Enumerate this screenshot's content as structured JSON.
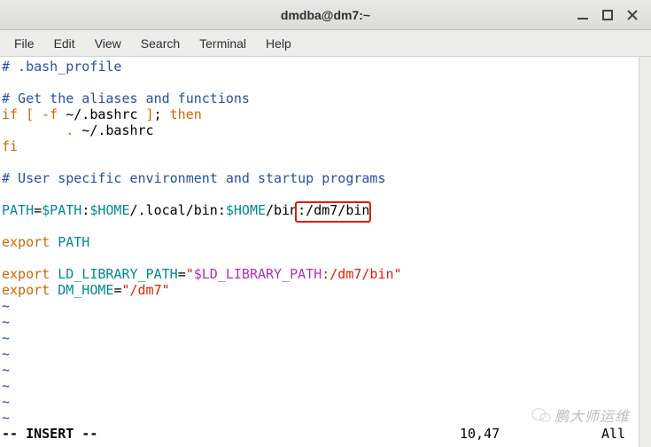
{
  "titlebar": {
    "title": "dmdba@dm7:~"
  },
  "menubar": {
    "file": "File",
    "edit": "Edit",
    "view": "View",
    "search": "Search",
    "terminal": "Terminal",
    "help": "Help"
  },
  "content": {
    "l1_comment": "# .bash_profile",
    "l3_comment": "# Get the aliases and functions",
    "l4_if": "if",
    "l4_br1": "[",
    "l4_flag": "-f",
    "l4_path": " ~/.bashrc ",
    "l4_br2": "]",
    "l4_semi": ";",
    "l4_then": "then",
    "l5_dot": ".",
    "l5_path": " ~/.bashrc",
    "l6_fi": "fi",
    "l8_comment": "# User specific environment and startup programs",
    "l10_path": "PATH",
    "l10_eq": "=",
    "l10_v1": "$PATH",
    "l10_c1": ":",
    "l10_v2": "$HOME",
    "l10_s1": "/.local/bin:",
    "l10_v3": "$HOME",
    "l10_s2": "/bin",
    "l10_hl": ":/dm7/bin",
    "l12_export": "export",
    "l12_path": "PATH",
    "l14_export": "export",
    "l14_var": "LD_LIBRARY_PATH",
    "l14_eq": "=",
    "l14_q1": "\"",
    "l14_val": "$LD_LIBRARY_PATH",
    "l14_app": ":/dm7/bin",
    "l14_q2": "\"",
    "l15_export": "export",
    "l15_var": "DM_HOME",
    "l15_eq": "=",
    "l15_q1": "\"",
    "l15_val": "/dm7",
    "l15_q2": "\"",
    "tilde": "~"
  },
  "status": {
    "mode": "-- INSERT --",
    "position": "10,47",
    "scroll": "All"
  },
  "watermark": {
    "text": "鹏大师运维"
  }
}
